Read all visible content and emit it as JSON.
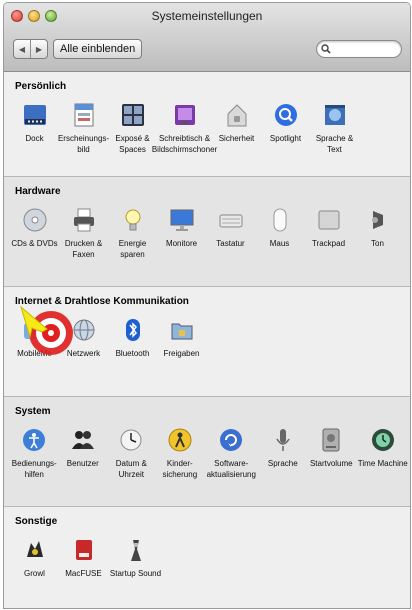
{
  "window": {
    "title": "Systemeinstellungen"
  },
  "toolbar": {
    "back": "◀",
    "forward": "▶",
    "show_all": "Alle einblenden",
    "search_placeholder": ""
  },
  "sections": [
    {
      "title": "Persönlich",
      "items": [
        {
          "label": "Dock",
          "icon": "dock-icon"
        },
        {
          "label": "Erscheinungs-\nbild",
          "icon": "appearance-icon"
        },
        {
          "label": "Exposé &\nSpaces",
          "icon": "expose-spaces-icon"
        },
        {
          "label": "Schreibtisch &\nBildschirmschoner",
          "icon": "desktop-screensaver-icon"
        },
        {
          "label": "Sicherheit",
          "icon": "security-icon"
        },
        {
          "label": "Spotlight",
          "icon": "spotlight-icon"
        },
        {
          "label": "Sprache &\nText",
          "icon": "language-text-icon"
        }
      ]
    },
    {
      "title": "Hardware",
      "items": [
        {
          "label": "CDs & DVDs",
          "icon": "cd-dvd-icon"
        },
        {
          "label": "Drucken &\nFaxen",
          "icon": "printer-icon"
        },
        {
          "label": "Energie\nsparen",
          "icon": "energy-saver-icon"
        },
        {
          "label": "Monitore",
          "icon": "monitor-icon"
        },
        {
          "label": "Tastatur",
          "icon": "keyboard-icon"
        },
        {
          "label": "Maus",
          "icon": "mouse-icon"
        },
        {
          "label": "Trackpad",
          "icon": "trackpad-icon"
        },
        {
          "label": "Ton",
          "icon": "sound-icon"
        }
      ]
    },
    {
      "title": "Internet & Drahtlose Kommunikation",
      "items": [
        {
          "label": "MobileMe",
          "icon": "mobileme-icon"
        },
        {
          "label": "Netzwerk",
          "icon": "network-icon"
        },
        {
          "label": "Bluetooth",
          "icon": "bluetooth-icon"
        },
        {
          "label": "Freigaben",
          "icon": "sharing-icon"
        }
      ]
    },
    {
      "title": "System",
      "items": [
        {
          "label": "Bedienungs-\nhilfen",
          "icon": "accessibility-icon"
        },
        {
          "label": "Benutzer",
          "icon": "users-icon"
        },
        {
          "label": "Datum &\nUhrzeit",
          "icon": "date-time-icon"
        },
        {
          "label": "Kinder-\nsicherung",
          "icon": "parental-controls-icon"
        },
        {
          "label": "Software-\naktualisierung",
          "icon": "software-update-icon"
        },
        {
          "label": "Sprache",
          "icon": "speech-icon"
        },
        {
          "label": "Startvolume",
          "icon": "startup-disk-icon"
        },
        {
          "label": "Time Machine",
          "icon": "time-machine-icon"
        }
      ]
    },
    {
      "title": "Sonstige",
      "items": [
        {
          "label": "Growl",
          "icon": "growl-icon"
        },
        {
          "label": "MacFUSE",
          "icon": "macfuse-icon"
        },
        {
          "label": "Startup Sound",
          "icon": "startup-sound-icon"
        }
      ]
    }
  ],
  "annotation": {
    "icon": "target-icon",
    "pointer_icon": "arrow-pointer-icon"
  }
}
